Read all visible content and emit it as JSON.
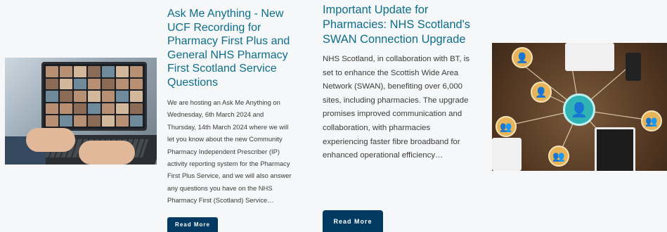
{
  "cards": [
    {
      "title": "Ask Me Anything - New UCF Recording for Pharmacy First Plus and General NHS Pharmacy First Scotland Service Questions",
      "excerpt": "We are hosting an Ask Me Anything on Wednesday, 6th March 2024 and Thursday, 14th March 2024 where we will let you know about the new Community Pharmacy Independent Prescriber (IP) activity reporting system for the Pharmacy First Plus Service, and we will also answer any questions you have on the NHS Pharmacy First (Scotland) Service…",
      "button_label": "Read More",
      "image": "laptop-video-call-image"
    },
    {
      "title": "Important Update for Pharmacies: NHS Scotland's SWAN Connection Upgrade",
      "excerpt": "NHS Scotland, in collaboration with BT, is set to enhance the Scottish Wide Area Network (SWAN), benefiting over 6,000 sites, including pharmacies. The upgrade promises improved communication and collaboration, with pharmacies experiencing faster fibre broadband for enhanced operational efficiency…",
      "button_label": "Read More",
      "image": "network-people-icons-image"
    }
  ],
  "colors": {
    "title": "#0d6e8c",
    "button_bg": "#003a63",
    "button_text": "#ffffff",
    "page_bg": "#f5f7f8"
  }
}
